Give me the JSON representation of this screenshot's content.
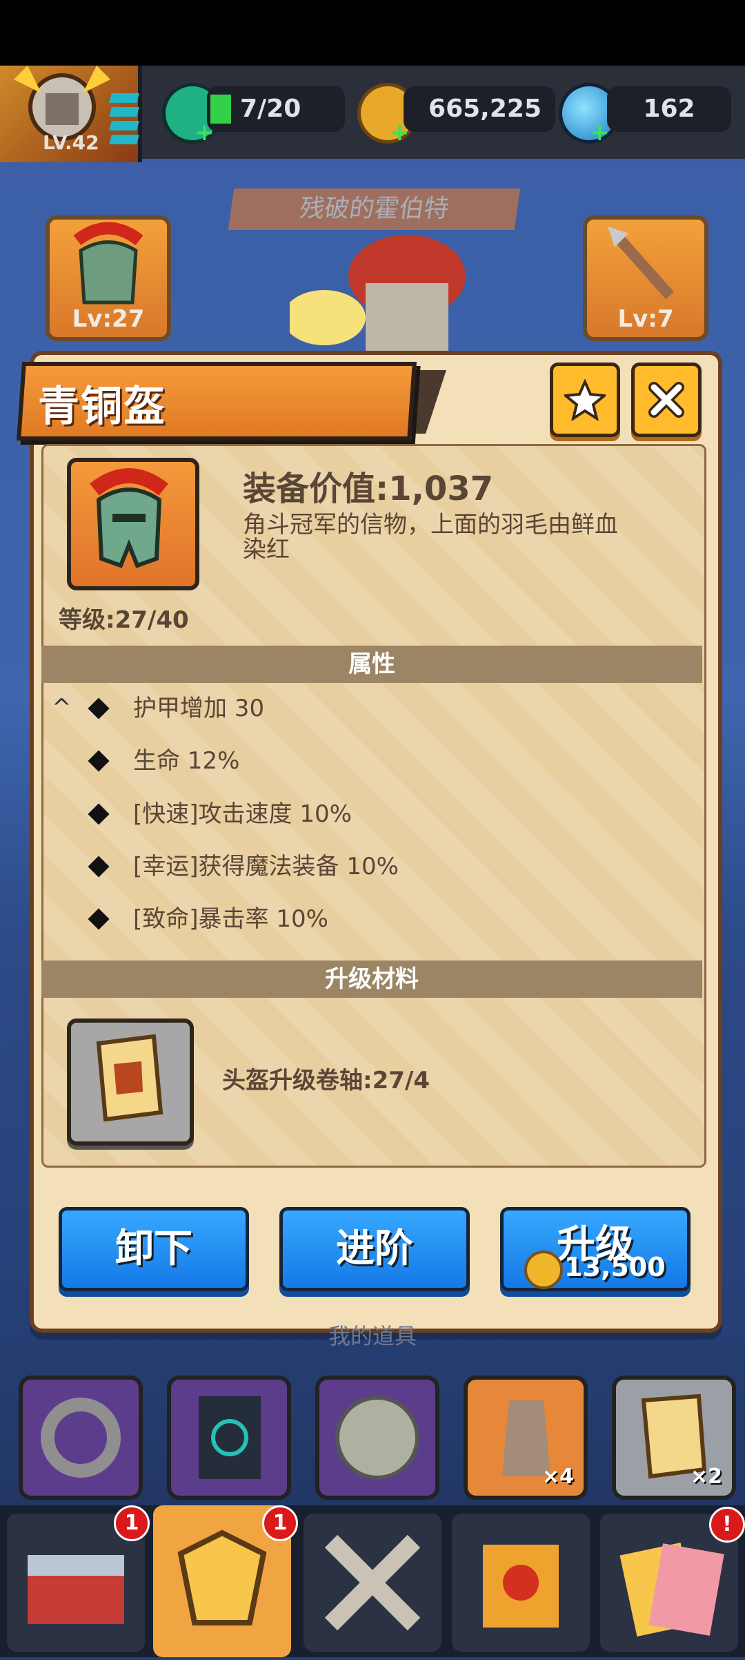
{
  "player": {
    "level_label": "LV.42"
  },
  "resources": {
    "energy": "7/20",
    "gold": "665,225",
    "gems": "162"
  },
  "background": {
    "hero_name": "残破的霍伯特",
    "left_slot_level": "Lv:27",
    "right_slot_level": "Lv:7",
    "under_dialog_label": "我的道具"
  },
  "dialog": {
    "title": "青铜盔",
    "value_label": "装备价值:1,037",
    "description": "角斗冠军的信物，上面的羽毛由鲜血染红",
    "level_label": "等级:27/40",
    "attributes_header": "属性",
    "attributes": [
      "护甲增加 30",
      "生命 12%",
      "[快速]攻击速度 10%",
      "[幸运]获得魔法装备 10%",
      "[致命]暴击率 10%"
    ],
    "materials_header": "升级材料",
    "material_text": "头盔升级卷轴:27/4",
    "buttons": {
      "unequip": "卸下",
      "advance": "进阶",
      "upgrade": "升级",
      "upgrade_cost": "13,500"
    }
  },
  "inventory": {
    "moai_qty": "×4",
    "scroll_qty": "×2"
  },
  "nav": {
    "badges": [
      "1",
      "1",
      "!"
    ]
  }
}
